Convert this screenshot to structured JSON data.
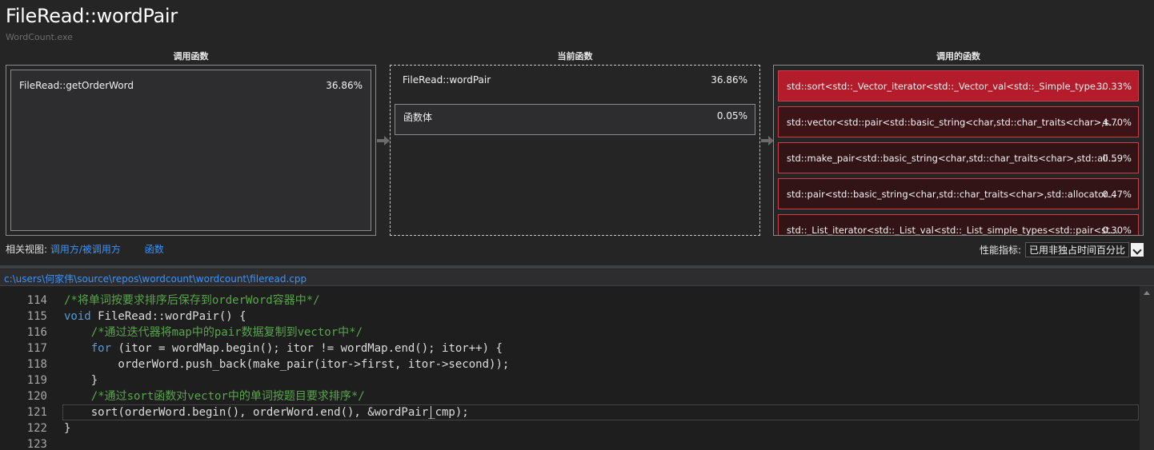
{
  "header": {
    "function_title": "FileRead::wordPair",
    "module": "WordCount.exe"
  },
  "columns": {
    "callers_title": "调用函数",
    "current_title": "当前函数",
    "callees_title": "调用的函数"
  },
  "callers": [
    {
      "name": "FileRead::getOrderWord",
      "pct": "36.86%"
    }
  ],
  "current": {
    "name": "FileRead::wordPair",
    "pct": "36.86%",
    "body_label": "函数体",
    "body_pct": "0.05%"
  },
  "callees": [
    {
      "name": "std::sort<std::_Vector_iterator<std::_Vector_val<std::_Simple_type...",
      "pct": "30.33%",
      "bg": "#b51c2b"
    },
    {
      "name": "std::vector<std::pair<std::basic_string<char,std::char_traits<char>,s...",
      "pct": "4.70%",
      "bg": "#3c1317"
    },
    {
      "name": "std::make_pair<std::basic_string<char,std::char_traits<char>,std::all...",
      "pct": "0.59%",
      "bg": "#321417"
    },
    {
      "name": "std::pair<std::basic_string<char,std::char_traits<char>,std::allocator...",
      "pct": "0.47%",
      "bg": "#321417"
    },
    {
      "name": "std::_List_iterator<std::_List_val<std::_List_simple_types<std::pair<st...",
      "pct": "0.30%",
      "bg": "#321417"
    }
  ],
  "related_views": {
    "label": "相关视图:",
    "link_caller_callee": "调用方/被调用方",
    "link_functions": "函数"
  },
  "metric": {
    "label": "性能指标:",
    "selected": "已用非独占时间百分比"
  },
  "file": {
    "path": "c:\\users\\何家伟\\source\\repos\\wordcount\\wordcount\\fileread.cpp"
  },
  "code": {
    "lines": [
      {
        "n": "114",
        "segments": [
          {
            "t": "cm",
            "s": "/*将单词按要求排序后保存到orderWord容器中*/"
          }
        ]
      },
      {
        "n": "115",
        "segments": [
          {
            "t": "kw",
            "s": "void"
          },
          {
            "t": "tx",
            "s": " FileRead::wordPair() {"
          }
        ]
      },
      {
        "n": "116",
        "segments": [
          {
            "t": "tx",
            "s": "    "
          },
          {
            "t": "cm",
            "s": "/*通过迭代器将map中的pair数据复制到vector中*/"
          }
        ]
      },
      {
        "n": "117",
        "segments": [
          {
            "t": "tx",
            "s": "    "
          },
          {
            "t": "kw",
            "s": "for"
          },
          {
            "t": "tx",
            "s": " (itor = wordMap.begin(); itor != wordMap.end(); itor++) {"
          }
        ]
      },
      {
        "n": "118",
        "segments": [
          {
            "t": "tx",
            "s": "        orderWord.push_back(make_pair(itor->first, itor->second));"
          }
        ]
      },
      {
        "n": "119",
        "segments": [
          {
            "t": "tx",
            "s": "    }"
          }
        ]
      },
      {
        "n": "120",
        "segments": [
          {
            "t": "tx",
            "s": "    "
          },
          {
            "t": "cm",
            "s": "/*通过sort函数对vector中的单词按题目要求排序*/"
          }
        ]
      },
      {
        "n": "121",
        "segments": [
          {
            "t": "tx",
            "s": "    sort(orderWord.begin(), orderWord.end(), &wordPair_cmp);"
          }
        ]
      },
      {
        "n": "122",
        "segments": [
          {
            "t": "tx",
            "s": "}"
          }
        ]
      },
      {
        "n": "123",
        "segments": []
      }
    ]
  }
}
